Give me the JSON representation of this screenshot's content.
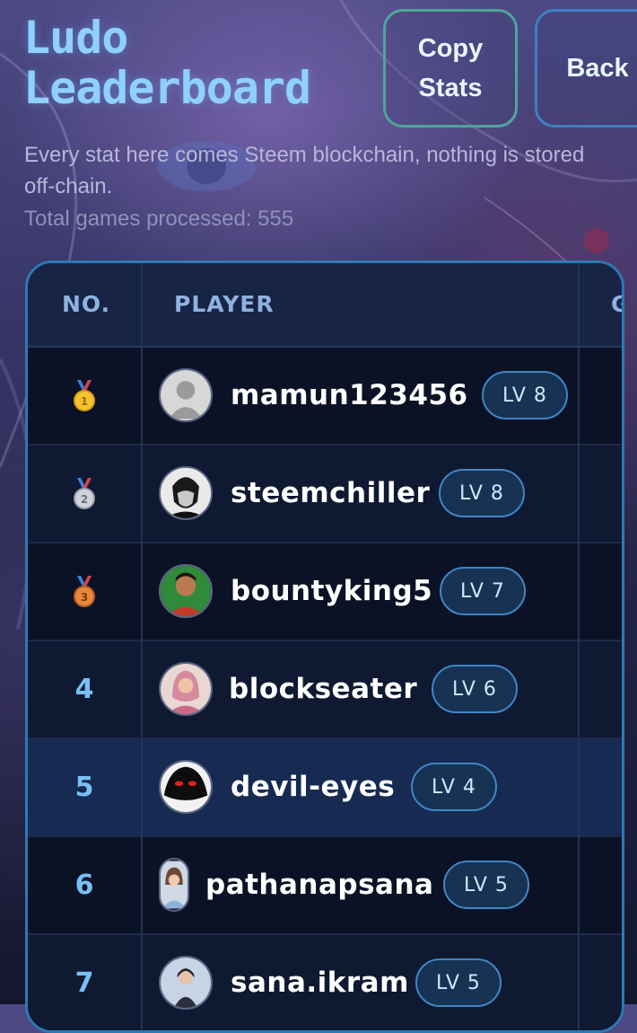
{
  "header": {
    "title": "Ludo\nLeaderboard",
    "copy_stats_label": "Copy\nStats",
    "back_label": "Back",
    "subtitle": "Every stat here comes Steem blockchain, nothing is stored off-chain.",
    "total_games": "Total games processed: 555"
  },
  "table": {
    "columns": [
      "NO.",
      "PLAYER",
      "G"
    ],
    "rows": [
      {
        "rank": "",
        "medal": "gold-medal-icon",
        "username": "mamun123456",
        "level": "LV 8",
        "avatar": "default-avatar-icon"
      },
      {
        "rank": "",
        "medal": "silver-medal-icon",
        "username": "steemchiller",
        "level": "LV 8",
        "avatar": "user-photo"
      },
      {
        "rank": "",
        "medal": "bronze-medal-icon",
        "username": "bountyking5",
        "level": "LV 7",
        "avatar": "user-photo"
      },
      {
        "rank": "4",
        "medal": "",
        "username": "blockseater",
        "level": "LV 6",
        "avatar": "user-photo"
      },
      {
        "rank": "5",
        "medal": "",
        "username": "devil-eyes",
        "level": "LV 4",
        "avatar": "user-photo"
      },
      {
        "rank": "6",
        "medal": "",
        "username": "pathanapsana",
        "level": "LV 5",
        "avatar": "user-photo"
      },
      {
        "rank": "7",
        "medal": "",
        "username": "sana.ikram",
        "level": "LV 5",
        "avatar": "user-photo"
      }
    ]
  },
  "colors": {
    "title": "#8fd0ff",
    "accent_border": "#2b7ab3",
    "copy_border": "#4fa59a",
    "rank_number": "#78c0f5",
    "highlight_row": "#162a52"
  }
}
